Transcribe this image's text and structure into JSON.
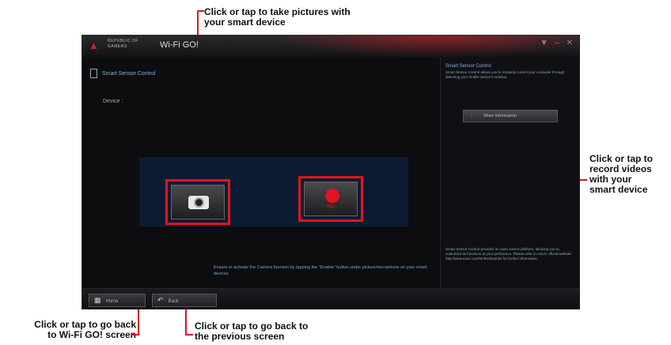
{
  "callouts": {
    "top": [
      "Click or tap to take pictures with",
      "your smart device"
    ],
    "right": [
      "Click or tap to",
      "record videos",
      "with your",
      "smart device"
    ],
    "bottom_left": [
      "Click or tap to go back",
      "to Wi-Fi GO! screen"
    ],
    "bottom_right": [
      "Click or tap to go back to",
      "the previous screen"
    ]
  },
  "window": {
    "brand": [
      "REPUBLIC OF",
      "GAMERS"
    ],
    "title": "Wi-Fi GO!"
  },
  "main": {
    "module_title": "Smart Sensor Control",
    "device_label": "Device :",
    "record_label": "REC",
    "hint": "Ensure to activate the Camera function by tapping the \"Enable\" button under picture/microphone on your smart devices."
  },
  "side": {
    "title": "Smart Sensor Control",
    "description": "Smart Sensor Control allows you to remotely control your computer through detecting your mobile device's motions.",
    "more_info_label": "More Information",
    "footer": "Smart Sensor Control provides an open source platform, allowing you to customize its functions at your preference. Please refer to ASUS official website: http://www.asus.com/Motherboards/ for further information."
  },
  "bottom": {
    "home_label": "Home",
    "back_label": "Back"
  },
  "colors": {
    "accent": "#d41c24",
    "highlight_border": "#e3141c",
    "stage_bg": "#0c1b33"
  },
  "icons": {
    "device": "smartphone-icon",
    "camera": "camera-icon",
    "record": "record-icon",
    "help": "question-icon",
    "home": "home-icon",
    "back": "back-arrow-icon"
  }
}
